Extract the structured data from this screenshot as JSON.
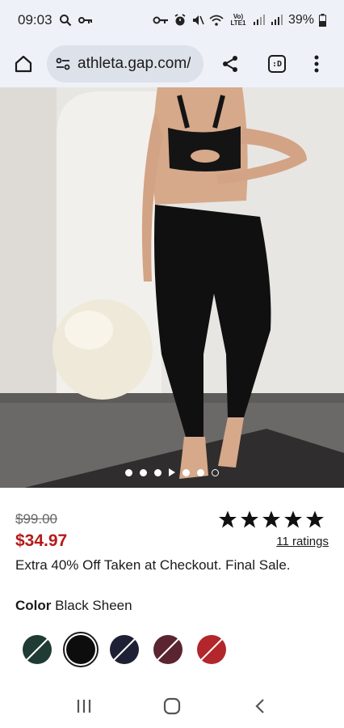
{
  "status_bar": {
    "time": "09:03",
    "battery_percent": "39%",
    "network_label": "Vo) LTE1"
  },
  "browser": {
    "url": "athleta.gap.com/",
    "tab_indicator": ":D"
  },
  "carousel": {
    "dots_before_play": 3,
    "dots_after_play": 2,
    "current_indicator": "hollow-last"
  },
  "product": {
    "original_price": "$99.00",
    "sale_price": "$34.97",
    "rating_stars": 5,
    "ratings_link": "11 ratings",
    "promo_text": "Extra 40% Off Taken at Checkout. Final Sale.",
    "color_label": "Color",
    "color_value": "Black Sheen",
    "swatches": [
      {
        "name": "dark-green",
        "color": "#1f3b33",
        "selected": false
      },
      {
        "name": "black",
        "color": "#0d0d0d",
        "selected": true
      },
      {
        "name": "navy",
        "color": "#1e2036",
        "selected": false
      },
      {
        "name": "burgundy",
        "color": "#5a2530",
        "selected": false
      },
      {
        "name": "red",
        "color": "#b3262b",
        "selected": false
      }
    ]
  },
  "colors": {
    "sale_red": "#b51a1a",
    "chrome_bg": "#eef1f7"
  }
}
